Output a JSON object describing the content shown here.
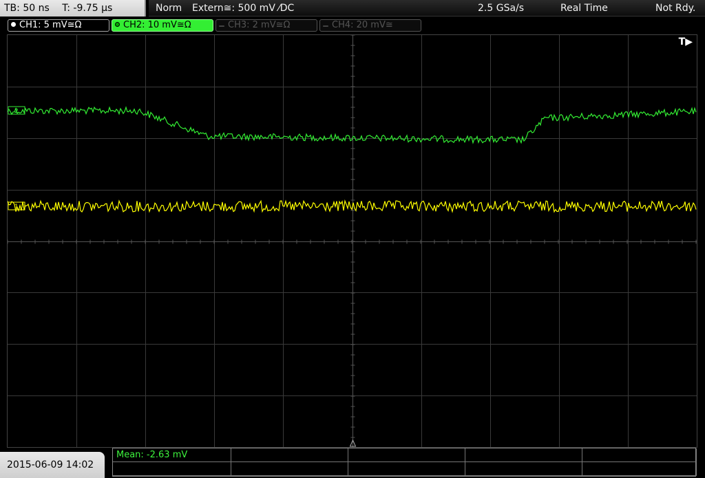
{
  "header": {
    "timebase": "TB: 50 ns",
    "trigger_time": "T: -9.75 µs",
    "mode": "Norm",
    "trigger_source": "Extern≅: 500 mV ⁄DC",
    "sample_rate": "2.5 GSa/s",
    "acq_mode": "Real Time",
    "state": "Not Rdy."
  },
  "channels": [
    {
      "label": "CH1: 5 mV≅Ω",
      "color": "#ffff00",
      "active": true
    },
    {
      "label": "CH2: 10 mV≅Ω",
      "color": "#33ee33",
      "active": true
    },
    {
      "label": "CH3: 2 mV≅Ω",
      "color": "#666666",
      "active": false
    },
    {
      "label": "CH4: 20 mV≅",
      "color": "#666666",
      "active": false
    }
  ],
  "screen": {
    "trigger_marker": "T▶",
    "ch1_marker": "1",
    "ch2_marker": "2"
  },
  "footer": {
    "datetime": "2015-06-09 14:02",
    "measurement": "Mean: -2.63 mV"
  },
  "colors": {
    "ch1": "#ffff00",
    "ch2": "#33ee33",
    "grid": "#3a3a3a",
    "grid_center": "#555555"
  }
}
